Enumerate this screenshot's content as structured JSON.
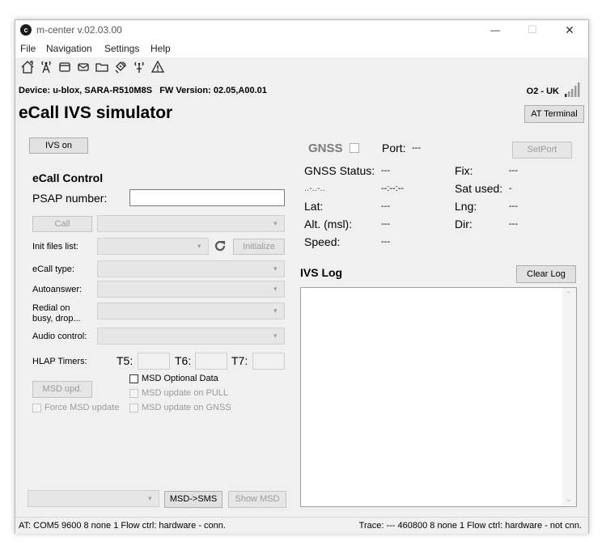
{
  "window": {
    "title": "m-center v.02.03.00",
    "app_icon_letter": "c"
  },
  "window_controls": {
    "minimize": "—",
    "maximize": "☐",
    "close": "✕"
  },
  "menu": {
    "items": [
      "File",
      "Navigation",
      "Settings",
      "Help"
    ]
  },
  "toolbar": {
    "icons": [
      "home-icon",
      "antenna-icon",
      "window-icon",
      "envelope-icon",
      "folder-icon",
      "satellite-icon",
      "signal-icon",
      "warning-icon"
    ]
  },
  "device": {
    "line": "Device: u-blox, SARA-R510M8S   FW Version: 02.05,A00.01"
  },
  "carrier": {
    "name": "O2 - UK",
    "signal_bars": 5
  },
  "header": {
    "title": "eCall IVS simulator",
    "at_terminal_label": "AT Terminal"
  },
  "ivs_on_label": "IVS on",
  "ecall_control": {
    "heading": "eCall Control",
    "psap_label": "PSAP number:",
    "psap_value": "",
    "call_label": "Call",
    "init_files_label": "Init files list:",
    "initialize_label": "Initialize",
    "ecall_type_label": "eCall type:",
    "autoanswer_label": "Autoanswer:",
    "redial_label_1": "Redial on",
    "redial_label_2": "busy, drop...",
    "audio_control_label": "Audio control:",
    "hlap_timers_label": "HLAP Timers:",
    "t5_label": "T5:",
    "t6_label": "T6:",
    "t7_label": "T7:",
    "msd_upd_label": "MSD upd.",
    "msd_optional_label": "MSD Optional Data",
    "msd_update_pull_label": "MSD update on PULL",
    "force_msd_label": "Force MSD update",
    "msd_update_gnss_label": "MSD update on GNSS",
    "msd_sms_label": "MSD->SMS",
    "show_msd_label": "Show MSD"
  },
  "gnss": {
    "label": "GNSS",
    "port_label": "Port:",
    "port_value": "---",
    "setport_label": "SetPort",
    "status_label": "GNSS Status:",
    "status_value": "---",
    "date_label": "..-..-..",
    "time_value": "--:--:--",
    "fix_label": "Fix:",
    "fix_value": "---",
    "sat_label": "Sat used:",
    "sat_value": "-",
    "lat_label": "Lat:",
    "lat_value": "---",
    "lng_label": "Lng:",
    "lng_value": "---",
    "alt_label": "Alt. (msl):",
    "alt_value": "---",
    "dir_label": "Dir:",
    "dir_value": "---",
    "speed_label": "Speed:",
    "speed_value": "---"
  },
  "ivs_log": {
    "heading": "IVS Log",
    "clear_label": "Clear Log"
  },
  "status_bar": {
    "left": "AT: COM5 9600 8 none 1 Flow ctrl: hardware - conn.",
    "right": "Trace: --- 460800 8 none 1 Flow ctrl: hardware - not cnn."
  }
}
